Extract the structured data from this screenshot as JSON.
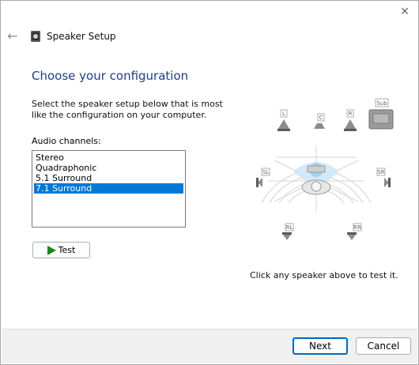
{
  "window": {
    "title": "Speaker Setup"
  },
  "heading": "Choose your configuration",
  "instructions": "Select the speaker setup below that is most like the configuration on your computer.",
  "channels": {
    "label": "Audio channels:",
    "options": [
      "Stereo",
      "Quadraphonic",
      "5.1 Surround",
      "7.1 Surround"
    ],
    "selected": "7.1 Surround"
  },
  "test_button": {
    "label": "Test"
  },
  "hint": "Click any speaker above to test it.",
  "speakers": {
    "L": "L",
    "C": "C",
    "R": "R",
    "Sub": "Sub",
    "SL": "SL",
    "SR": "SR",
    "RL": "RL",
    "RR": "RR"
  },
  "footer": {
    "next": "Next",
    "cancel": "Cancel"
  },
  "icons": {
    "close": "close-icon",
    "back": "back-arrow-icon",
    "play": "play-icon",
    "speaker": "speaker-icon"
  },
  "colors": {
    "accent": "#0078d7",
    "heading": "#1c3d8f",
    "play": "#178a17"
  }
}
